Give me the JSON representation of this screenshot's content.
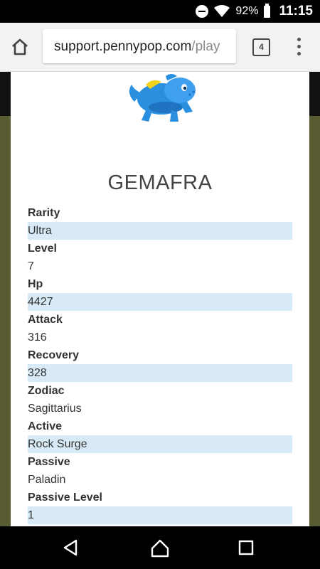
{
  "status_bar": {
    "battery_percent": "92%",
    "time": "11:15",
    "icons": [
      "do-not-disturb-icon",
      "wifi-icon",
      "battery-icon"
    ]
  },
  "browser": {
    "url_main": "support.pennypop.com",
    "url_rest": "/play",
    "tab_count": "4",
    "icons": [
      "home-icon",
      "tabs-icon",
      "overflow-menu-icon"
    ]
  },
  "monster": {
    "name": "GEMAFRA",
    "colors": {
      "body": "#2b8fe0",
      "accent": "#f2d21b"
    }
  },
  "stats": [
    {
      "label": "Rarity",
      "value": "Ultra"
    },
    {
      "label": "Level",
      "value": "7"
    },
    {
      "label": "Hp",
      "value": "4427"
    },
    {
      "label": "Attack",
      "value": "316"
    },
    {
      "label": "Recovery",
      "value": "328"
    },
    {
      "label": "Zodiac",
      "value": "Sagittarius"
    },
    {
      "label": "Active",
      "value": "Rock Surge"
    },
    {
      "label": "Passive",
      "value": "Paladin"
    },
    {
      "label": "Passive Level",
      "value": "1"
    }
  ],
  "nav": {
    "icons": [
      "back-icon",
      "home-icon",
      "recents-icon"
    ]
  },
  "colors": {
    "row_highlight": "#d7eaf6",
    "page_background": "#595b33"
  }
}
